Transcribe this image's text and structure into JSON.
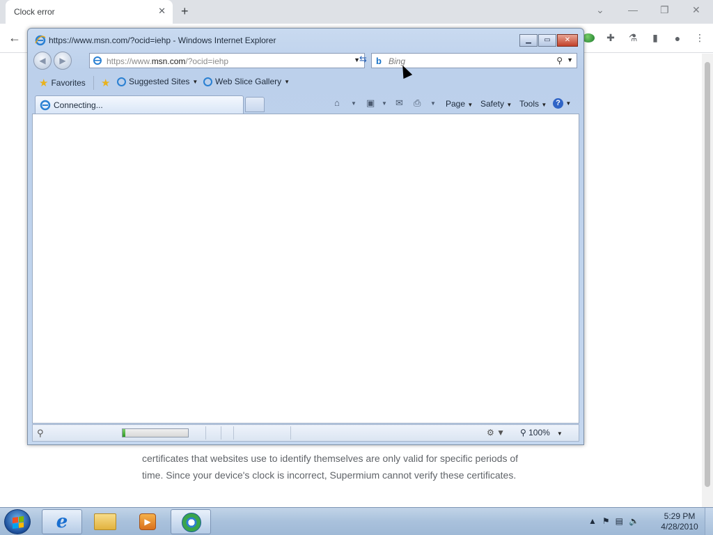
{
  "chrome": {
    "tab_title": "Clock error",
    "tab_close": "✕",
    "new_tab": "+",
    "window_controls": {
      "minimize": "—",
      "maximize": "❐",
      "close": "✕",
      "dropdown": "⌄"
    },
    "back": "←",
    "page_text_line1": "certificates that websites use to identify themselves are only valid for specific periods of",
    "page_text_line2": "time. Since your device's clock is incorrect, Supermium cannot verify these certificates."
  },
  "ie": {
    "title": "https://www.msn.com/?ocid=iehp - Windows Internet Explorer",
    "address_prefix": "https://www.",
    "address_domain": "msn.com",
    "address_suffix": "/?ocid=iehp",
    "search_placeholder": "Bing",
    "favorites": {
      "favorites_label": "Favorites",
      "suggested_sites_label": "Suggested Sites",
      "web_slice_gallery_label": "Web Slice Gallery"
    },
    "tab_label": "Connecting...",
    "commands": {
      "page": "Page",
      "safety": "Safety",
      "tools": "Tools"
    },
    "status": {
      "progress": 0.04,
      "zoom": "100%"
    }
  },
  "taskbar": {
    "time": "5:29 PM",
    "date": "4/28/2010"
  },
  "colors": {
    "ie_frame": "#c4d7ef",
    "taskbar": "#a9c1dc",
    "close_red": "#c2412a",
    "progress_green": "#2f9a24"
  }
}
